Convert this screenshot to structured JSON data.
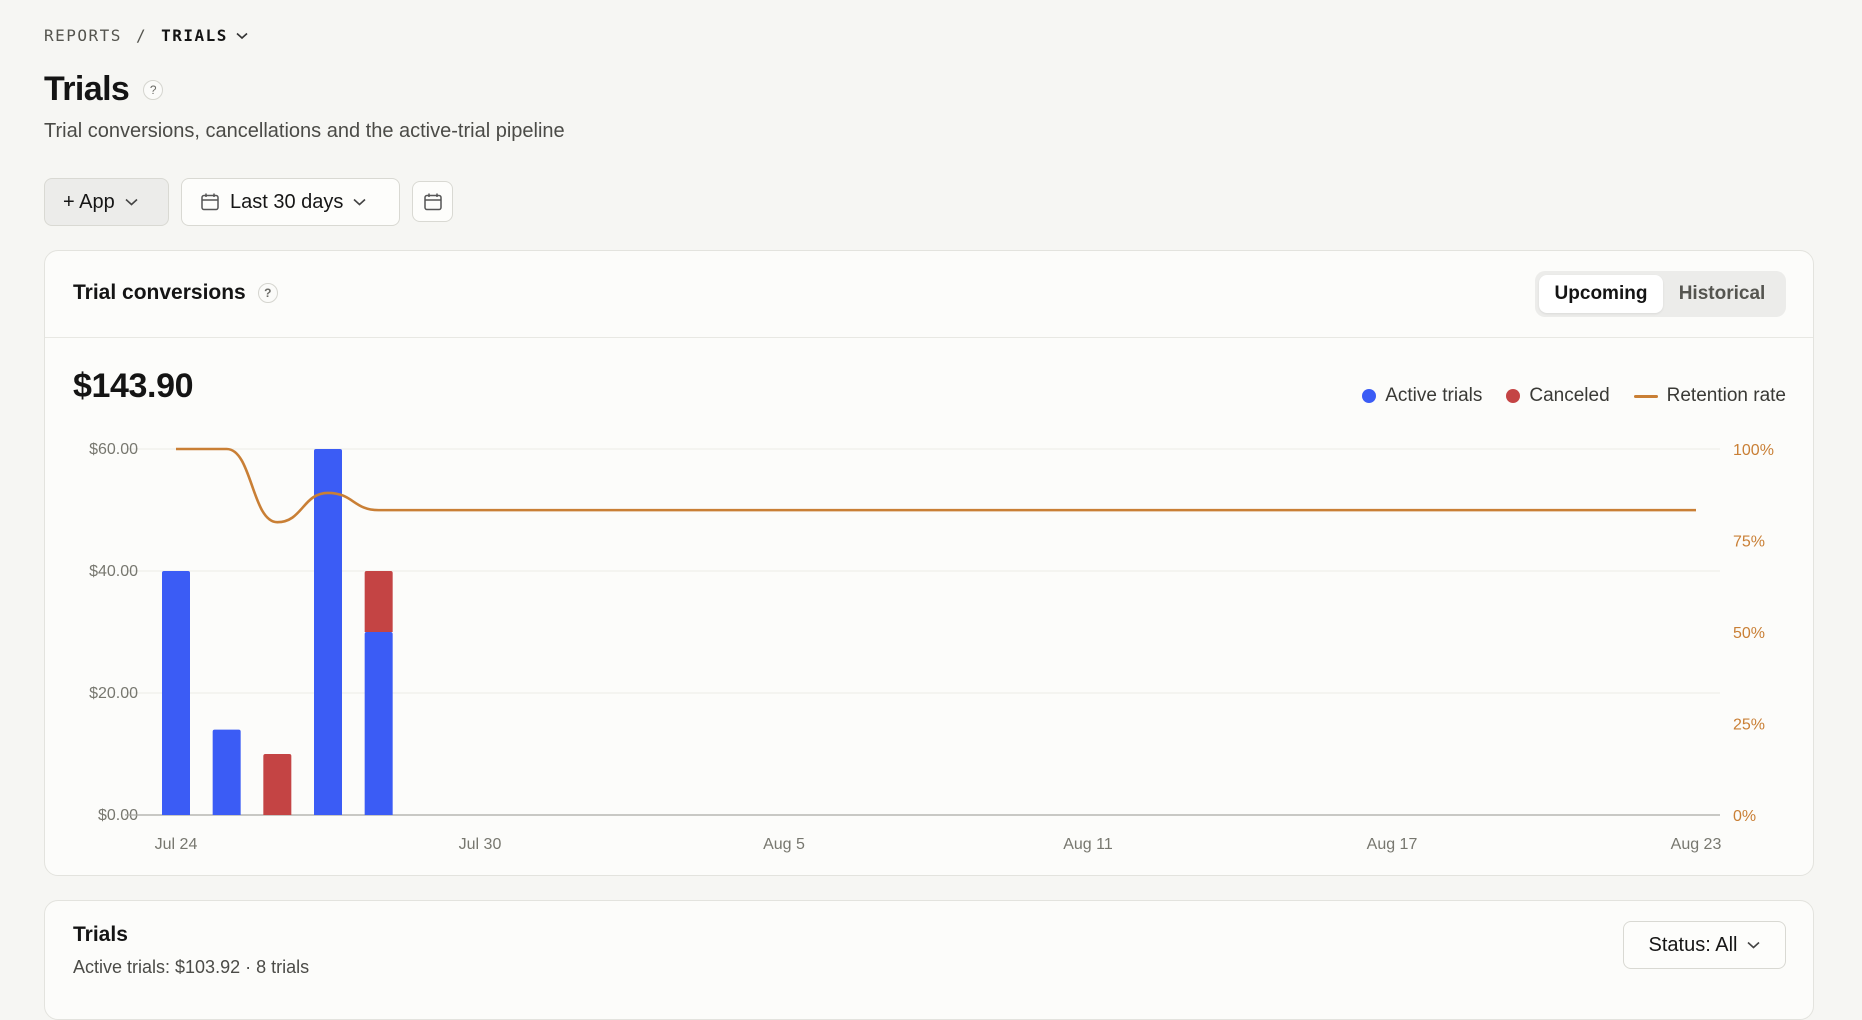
{
  "breadcrumb": {
    "parent": "REPORTS",
    "separator": "/",
    "current": "TRIALS"
  },
  "header": {
    "title": "Trials",
    "help": "?",
    "subtitle": "Trial conversions, cancellations and the active-trial pipeline"
  },
  "toolbar": {
    "app_label": "+ App",
    "date_range": "Last 30 days"
  },
  "conversions": {
    "title": "Trial conversions",
    "help": "?",
    "tabs": [
      {
        "label": "Upcoming",
        "active": true
      },
      {
        "label": "Historical",
        "active": false
      }
    ],
    "total": "$143.90",
    "legend": [
      "Active trials",
      "Canceled",
      "Retention rate"
    ]
  },
  "colors": {
    "active": "#3b5cf5",
    "canceled": "#c44444",
    "retention": "#c97f35"
  },
  "chart_data": {
    "type": "bar",
    "x_tick_labels": [
      "Jul 24",
      "Jul 30",
      "Aug 5",
      "Aug 11",
      "Aug 17",
      "Aug 23"
    ],
    "categories": [
      "Jul 24",
      "Jul 25",
      "Jul 26",
      "Jul 27",
      "Jul 28"
    ],
    "series": [
      {
        "name": "Active trials",
        "values": [
          40,
          14,
          0,
          60,
          30
        ]
      },
      {
        "name": "Canceled",
        "values": [
          0,
          0,
          10,
          0,
          10
        ]
      }
    ],
    "line_series": {
      "name": "Retention rate",
      "x": [
        "Jul 24",
        "Jul 25",
        "Jul 26",
        "Jul 27",
        "Jul 28",
        "Aug 23"
      ],
      "values": [
        100,
        100,
        80,
        88,
        83.3,
        83.3
      ]
    },
    "y_left": {
      "ticks": [
        "$0.00",
        "$20.00",
        "$40.00",
        "$60.00"
      ],
      "ylim": [
        0,
        60
      ]
    },
    "y_right": {
      "ticks": [
        "0%",
        "25%",
        "50%",
        "75%",
        "100%"
      ],
      "ylim": [
        0,
        100
      ]
    },
    "stacked": true,
    "grid": true,
    "legend_position": "top-right"
  },
  "trials": {
    "title": "Trials",
    "summary": "Active trials: $103.92 · 8 trials",
    "status_filter": "Status: All"
  }
}
